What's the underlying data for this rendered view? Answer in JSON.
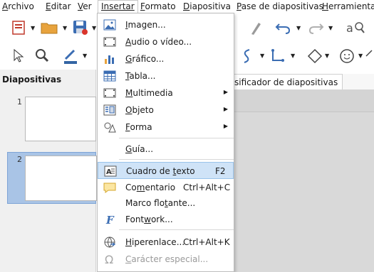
{
  "menubar": {
    "items": [
      {
        "label": "Archivo",
        "key": "A",
        "rest": "rchivo"
      },
      {
        "label": "Editar",
        "key": "E",
        "rest": "ditar"
      },
      {
        "label": "Ver",
        "key": "V",
        "rest": "er"
      },
      {
        "label": "Insertar",
        "key": "I",
        "rest": "nsertar"
      },
      {
        "label": "Formato",
        "key": "F",
        "rest": "ormato"
      },
      {
        "label": "Diapositiva",
        "key": "D",
        "rest": "iapositiva"
      },
      {
        "label": "Pase de diapositivas",
        "key": "P",
        "rest": "ase de diapositivas"
      },
      {
        "label": "Herramientas",
        "key": "H",
        "rest": "erramientas"
      }
    ]
  },
  "left_panel": {
    "title": "Diapositivas",
    "slides": [
      {
        "number": "1",
        "selected": false
      },
      {
        "number": "2",
        "selected": true
      }
    ]
  },
  "tabs": {
    "visible_tab": "sificador de diapositivas"
  },
  "insert_menu": {
    "items": [
      {
        "pre": "",
        "key": "I",
        "post": "magen...",
        "shortcut": "",
        "submenu": false,
        "icon": "image-icon",
        "disabled": false
      },
      {
        "pre": "",
        "key": "A",
        "post": "udio o vídeo...",
        "shortcut": "",
        "submenu": false,
        "icon": "audio-video-icon",
        "disabled": false
      },
      {
        "pre": "",
        "key": "G",
        "post": "ráfico...",
        "shortcut": "",
        "submenu": false,
        "icon": "chart-icon",
        "disabled": false
      },
      {
        "pre": "",
        "key": "T",
        "post": "abla...",
        "shortcut": "",
        "submenu": false,
        "icon": "table-icon",
        "disabled": false
      },
      {
        "pre": "",
        "key": "M",
        "post": "ultimedia",
        "shortcut": "",
        "submenu": true,
        "icon": "multimedia-icon",
        "disabled": false
      },
      {
        "pre": "",
        "key": "O",
        "post": "bjeto",
        "shortcut": "",
        "submenu": true,
        "icon": "object-icon",
        "disabled": false
      },
      {
        "pre": "",
        "key": "F",
        "post": "orma",
        "shortcut": "",
        "submenu": true,
        "icon": "shape-icon",
        "disabled": false
      },
      {
        "pre": "",
        "key": "G",
        "post": "uía...",
        "shortcut": "",
        "submenu": false,
        "icon": "",
        "disabled": false
      },
      {
        "pre": "Cuadro de ",
        "key": "t",
        "post": "exto",
        "shortcut": "F2",
        "submenu": false,
        "icon": "text-box-icon",
        "disabled": false,
        "highlighted": true
      },
      {
        "pre": "Co",
        "key": "m",
        "post": "entario",
        "shortcut": "Ctrl+Alt+C",
        "submenu": false,
        "icon": "comment-icon",
        "disabled": false
      },
      {
        "pre": "Marco flo",
        "key": "t",
        "post": "ante...",
        "shortcut": "",
        "submenu": false,
        "icon": "",
        "disabled": false
      },
      {
        "pre": "Font",
        "key": "w",
        "post": "ork...",
        "shortcut": "",
        "submenu": false,
        "icon": "fontwork-icon",
        "disabled": false
      },
      {
        "pre": "",
        "key": "H",
        "post": "iperenlace...",
        "shortcut": "Ctrl+Alt+K",
        "submenu": false,
        "icon": "hyperlink-icon",
        "disabled": false
      },
      {
        "pre": "",
        "key": "C",
        "post": "arácter especial...",
        "shortcut": "",
        "submenu": false,
        "icon": "omega-icon",
        "disabled": true
      }
    ]
  },
  "colors": {
    "highlight": "#cfe3f7",
    "accent_blue": "#3b6db3",
    "panel_bg": "#f0f0f0",
    "selected_thumb": "#a9c4e6"
  }
}
